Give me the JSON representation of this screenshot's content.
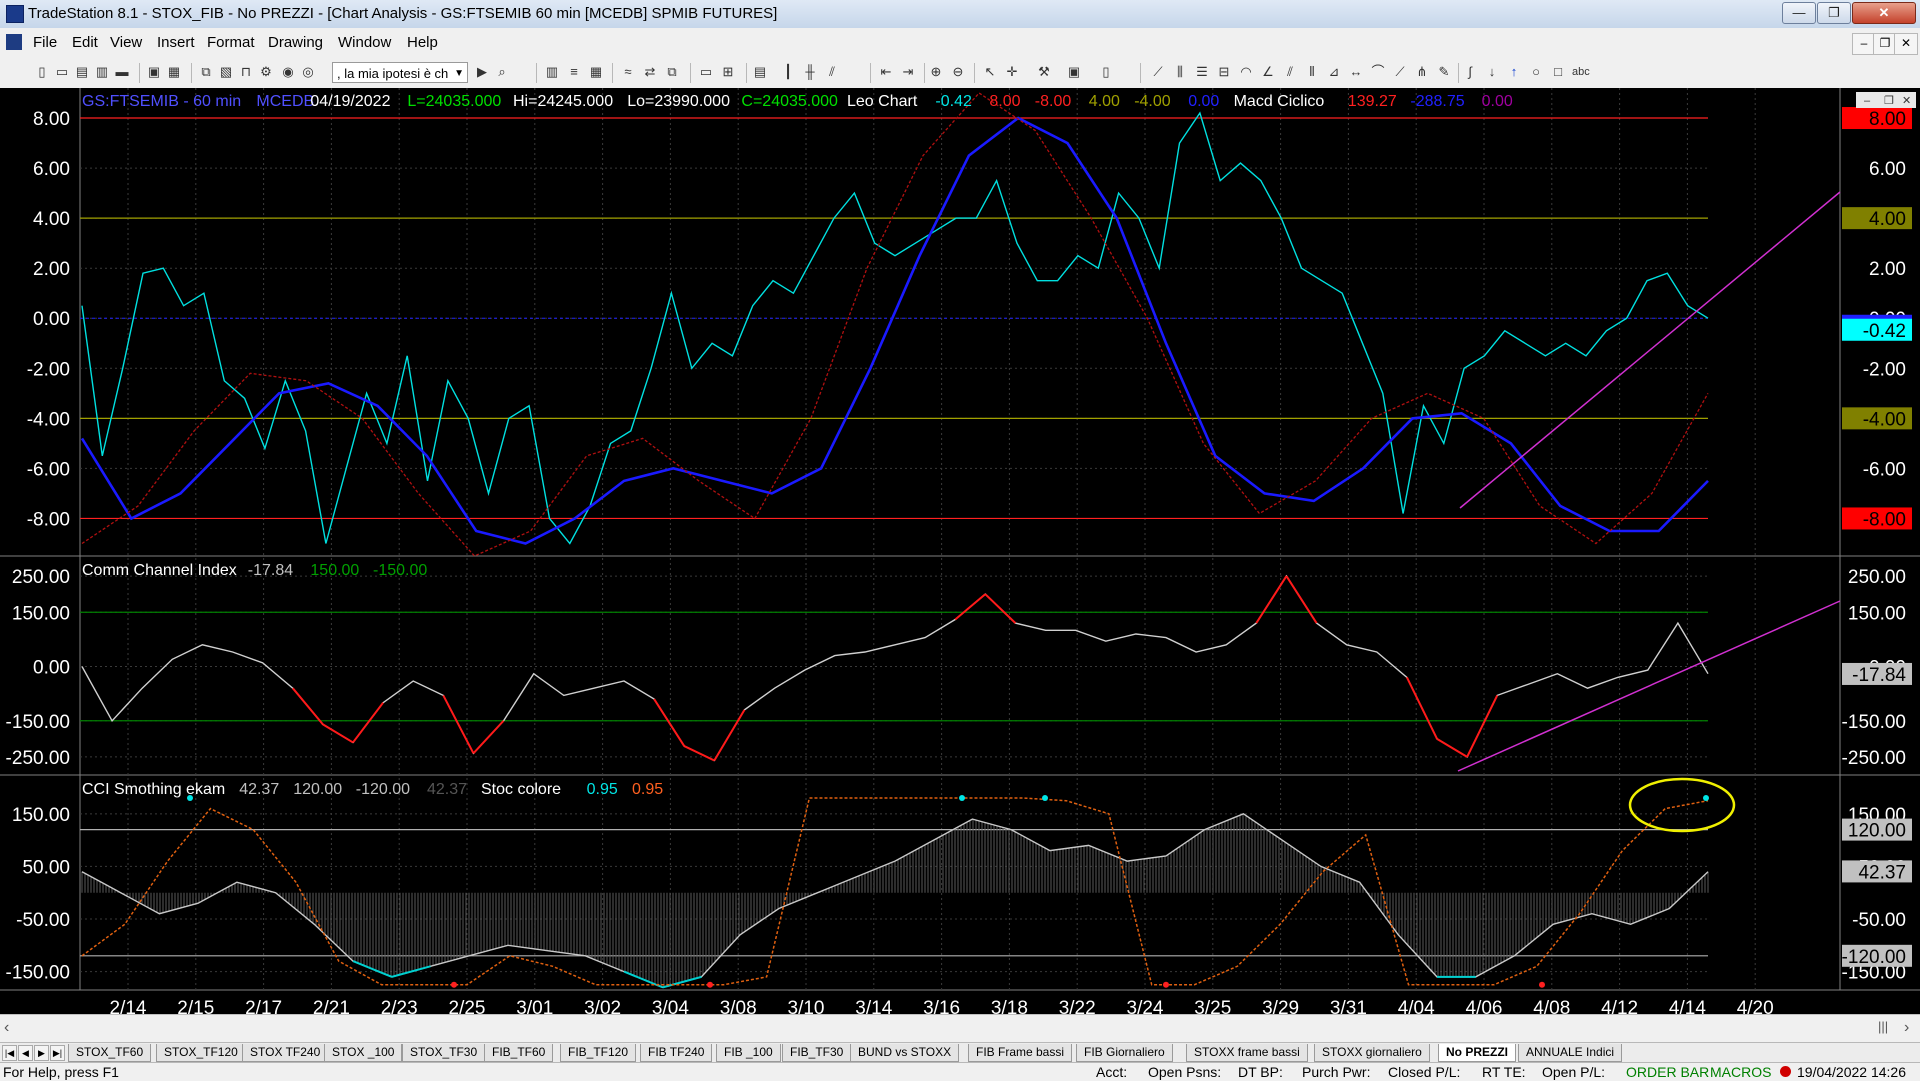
{
  "window": {
    "title": "TradeStation 8.1 - STOX_FIB - No PREZZI - [Chart Analysis - GS:FTSEMIB  60 min  [MCEDB] SPMIB FUTURES]",
    "min_glyph": "—",
    "max_glyph": "❐",
    "close_glyph": "✕"
  },
  "menu": {
    "items": [
      "File",
      "Edit",
      "View",
      "Insert",
      "Format",
      "Drawing",
      "Window",
      "Help"
    ],
    "mdi_min": "–",
    "mdi_restore": "❐",
    "mdi_close": "✕"
  },
  "toolbar": {
    "combo_value": ", la mia ipotesi è ch",
    "combo_arrow": "▼"
  },
  "chart_header": {
    "symbol": "GS:FTSEMIB - 60 min",
    "datafeed": "MCEDB",
    "date": "04/19/2022",
    "last": "L=24035.000",
    "high": "Hi=24245.000",
    "low": "Lo=23990.000",
    "close": "C=24035.000",
    "ind1_name": "Leo Chart",
    "ind1_values": [
      "-0.42",
      "8.00",
      "-8.00",
      "4.00",
      "-4.00",
      "0.00"
    ],
    "ind1_colors": [
      "#00e5e5",
      "#ff2020",
      "#ff2020",
      "#a0a000",
      "#a0a000",
      "#2020ff"
    ],
    "ind2_name": "Macd Ciclico",
    "ind2_values": [
      "139.27",
      "-288.75",
      "0.00"
    ],
    "ind2_colors": [
      "#ff2020",
      "#2020ff",
      "#a000a0"
    ]
  },
  "panel2_header": {
    "name": "Comm Channel Index",
    "values": [
      "-17.84",
      "150.00",
      "-150.00"
    ],
    "colors": [
      "#c0c0c0",
      "#00a000",
      "#00a000"
    ]
  },
  "panel3_header": {
    "name": "CCI Smothing ekam",
    "values": [
      "42.37",
      "120.00",
      "-120.00",
      "42.37"
    ],
    "colors": [
      "#c0c0c0",
      "#c0c0c0",
      "#c0c0c0",
      "#555555"
    ],
    "name2": "Stoc colore",
    "values2": [
      "0.95",
      "0.95"
    ],
    "colors2": [
      "#00e5e5",
      "#ff6020"
    ]
  },
  "chart_data": [
    {
      "type": "line",
      "panel": "Leo Chart",
      "x_labels": [
        "2/14",
        "2/15",
        "2/17",
        "2/21",
        "2/23",
        "2/25",
        "3/01",
        "3/02",
        "3/04",
        "3/08",
        "3/10",
        "3/14",
        "3/16",
        "3/18",
        "3/22",
        "3/24",
        "3/25",
        "3/29",
        "3/31",
        "4/04",
        "4/06",
        "4/08",
        "4/12",
        "4/14",
        "4/20"
      ],
      "ylim": [
        -9.5,
        9.2
      ],
      "y_ticks": [
        "8.00",
        "6.00",
        "4.00",
        "2.00",
        "0.00",
        "-2.00",
        "-4.00",
        "-6.00",
        "-8.00"
      ],
      "levels": [
        {
          "value": 8,
          "color": "#ff2020",
          "label": "8.00"
        },
        {
          "value": 4,
          "color": "#a0a000",
          "label": "4.00"
        },
        {
          "value": -4,
          "color": "#a0a000",
          "label": "-4.00"
        },
        {
          "value": -8,
          "color": "#ff2020",
          "label": "-8.00"
        }
      ],
      "last_value_label": "-0.42",
      "series": [
        {
          "name": "Leo Chart",
          "color": "#00e0e0",
          "values": [
            0.5,
            -5.5,
            -2,
            1.8,
            2,
            0.5,
            1,
            -2.5,
            -3.2,
            -5.2,
            -2.5,
            -4.5,
            -9,
            -6,
            -3,
            -5,
            -1.5,
            -6.5,
            -2.5,
            -4,
            -7,
            -4,
            -3.5,
            -8,
            -9,
            -7.5,
            -5,
            -4.5,
            -2,
            1,
            -2,
            -1,
            -1.5,
            0.5,
            1.5,
            1,
            2.5,
            4,
            5,
            3,
            2.5,
            3,
            3.5,
            4,
            4,
            5.5,
            3,
            1.5,
            1.5,
            2.5,
            2,
            5,
            4,
            2,
            7,
            8.2,
            5.5,
            6.2,
            5.5,
            4,
            2,
            1.5,
            1,
            -1,
            -3,
            -7.8,
            -3.5,
            -5,
            -2,
            -1.5,
            -0.5,
            -1,
            -1.5,
            -1,
            -1.5,
            -0.5,
            0,
            1.5,
            1.8,
            0.5,
            0
          ]
        },
        {
          "name": "Macd Ciclico",
          "color": "#1a1aff",
          "values": [
            -4.8,
            -8,
            -7,
            -5,
            -3,
            -2.6,
            -3.5,
            -5.5,
            -8.5,
            -9,
            -8,
            -6.5,
            -6,
            -6.5,
            -7,
            -6,
            -2,
            2.5,
            6.5,
            8,
            7,
            4,
            -1,
            -5.5,
            -7,
            -7.3,
            -6,
            -4,
            -3.8,
            -5,
            -7.5,
            -8.5,
            -8.5,
            -6.5
          ]
        },
        {
          "name": "Macd Ciclico (signal)",
          "color": "#b01010",
          "values": [
            -9,
            -7.5,
            -4.5,
            -2.2,
            -2.5,
            -4,
            -7,
            -9.5,
            -8.5,
            -5.5,
            -4.8,
            -6.5,
            -8,
            -4,
            2,
            6.5,
            9,
            7.5,
            4,
            0,
            -5,
            -7.8,
            -6.5,
            -4,
            -3,
            -4,
            -7.5,
            -9,
            -7,
            -3
          ]
        }
      ]
    },
    {
      "type": "line",
      "panel": "Comm Channel Index",
      "ylim": [
        -300,
        300
      ],
      "y_ticks": [
        "250.00",
        "150.00",
        "0.00",
        "-150.00",
        "-250.00"
      ],
      "y_tick_labels_right": [
        "250.00",
        "150.00",
        "-150.00",
        "-250.00"
      ],
      "levels": [
        {
          "value": 150,
          "color": "#008000"
        },
        {
          "value": -150,
          "color": "#008000"
        }
      ],
      "last_value_label": "-17.84",
      "series": [
        {
          "name": "Comm Channel Index",
          "color": "#d0d0d0",
          "values": [
            0,
            -150,
            -60,
            20,
            60,
            40,
            10,
            -60,
            -160,
            -210,
            -100,
            -40,
            -80,
            -240,
            -150,
            -20,
            -80,
            -60,
            -40,
            -90,
            -220,
            -260,
            -120,
            -60,
            -10,
            30,
            40,
            60,
            80,
            130,
            200,
            120,
            100,
            100,
            70,
            90,
            80,
            40,
            60,
            120,
            250,
            120,
            60,
            40,
            -30,
            -200,
            -250,
            -80,
            -50,
            -20,
            -60,
            -30,
            -10,
            120,
            -20
          ]
        }
      ]
    },
    {
      "type": "line",
      "panel": "CCI Smothing ekam",
      "ylim": [
        -185,
        220
      ],
      "y_ticks": [
        "150.00",
        "50.00",
        "-50.00",
        "-150.00"
      ],
      "levels": [
        {
          "value": 120,
          "color": "#b0b0b0",
          "label": "120.00"
        },
        {
          "value": -120,
          "color": "#b0b0b0",
          "label": "-120.00"
        }
      ],
      "last_value_label": "42.37",
      "series": [
        {
          "name": "CCI Smothing ekam",
          "color": "#c8c8c8",
          "values": [
            40,
            0,
            -40,
            -20,
            20,
            0,
            -60,
            -130,
            -160,
            -140,
            -120,
            -100,
            -110,
            -120,
            -150,
            -180,
            -160,
            -80,
            -30,
            0,
            30,
            60,
            100,
            140,
            120,
            80,
            90,
            60,
            70,
            120,
            150,
            100,
            50,
            20,
            -80,
            -160,
            -160,
            -120,
            -60,
            -40,
            -60,
            -30,
            40
          ]
        },
        {
          "name": "Stoc colore",
          "color": "#e06010",
          "values": [
            -120,
            -60,
            60,
            160,
            120,
            20,
            -130,
            -175,
            -175,
            -175,
            -120,
            -140,
            -175,
            -175,
            -175,
            -175,
            -160,
            180,
            180,
            180,
            180,
            180,
            180,
            175,
            150,
            -175,
            -175,
            -140,
            -60,
            40,
            110,
            -175,
            -175,
            -175,
            -140,
            -40,
            80,
            160,
            175
          ]
        }
      ]
    }
  ],
  "scroll": {
    "left": "‹",
    "right": "›"
  },
  "tabs": [
    "STOX_TF60",
    "STOX_TF120",
    "STOX TF240",
    "STOX _100",
    "STOX_TF30",
    "FIB_TF60",
    "FIB_TF120",
    "FIB TF240",
    "FIB _100",
    "FIB_TF30",
    "BUND vs STOXX",
    "FIB Frame bassi",
    "FIB Giornaliero",
    "STOXX frame bassi",
    "STOXX giornaliero",
    "No PREZZI",
    "ANNUALE Indici"
  ],
  "active_tab": "No PREZZI",
  "status": {
    "help": "For Help, press F1",
    "acct": "Acct:",
    "open_psns": "Open Psns:",
    "dt_bp": "DT BP:",
    "purch_pwr": "Purch Pwr:",
    "closed_pl": "Closed P/L:",
    "rt_te": "RT TE:",
    "open_pl": "Open P/L:",
    "order_bar": "ORDER BAR",
    "macros": "MACROS",
    "datetime": "19/04/2022 14:26"
  }
}
